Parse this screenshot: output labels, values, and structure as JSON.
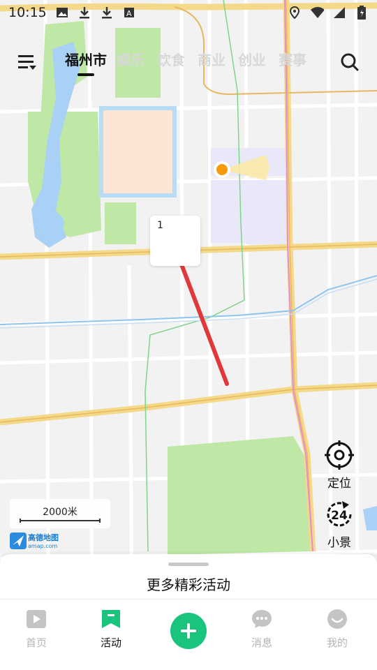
{
  "status_bar": {
    "time": "10:15"
  },
  "topbar": {
    "tabs": [
      {
        "label": "福州市"
      },
      {
        "label": "娱乐"
      },
      {
        "label": "饮食"
      },
      {
        "label": "商业"
      },
      {
        "label": "创业"
      },
      {
        "label": "赛事"
      }
    ]
  },
  "map": {
    "popup_label": "1",
    "scale_label": "2000米",
    "logo_text": "高德地图",
    "logo_url": "amap.com"
  },
  "float_buttons": {
    "locate_label": "定位",
    "scene_label": "小景",
    "scene_badge": "24"
  },
  "sheet": {
    "title": "更多精彩活动"
  },
  "nav": {
    "items": [
      {
        "label": "首页"
      },
      {
        "label": "活动"
      },
      {
        "label": "消息"
      },
      {
        "label": "我的"
      }
    ]
  },
  "colors": {
    "accent": "#1bc47d",
    "arrow": "#e0393b",
    "location_dot": "#f59b0b",
    "water": "#a9d0f5",
    "park": "#bfe8a6",
    "road_major": "#f5d98b"
  },
  "icons": [
    "image-icon",
    "download-icon",
    "download-icon",
    "font-icon",
    "location-pin-icon",
    "wifi-icon",
    "signal-icon",
    "battery-icon",
    "menu-icon",
    "search-icon",
    "target-icon",
    "rotate-24-icon",
    "video-icon",
    "bookmark-icon",
    "plus-icon",
    "chat-icon",
    "smile-icon"
  ]
}
